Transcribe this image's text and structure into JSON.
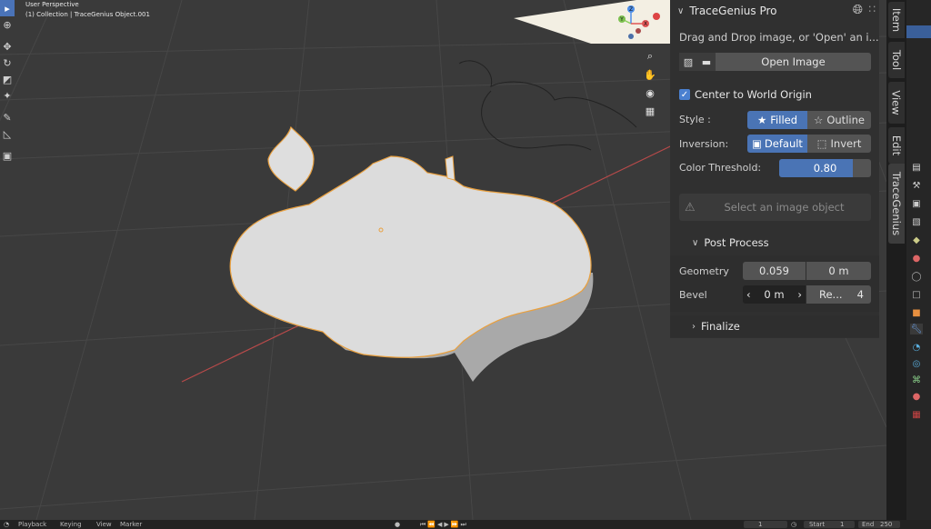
{
  "viewport": {
    "perspective": "User Perspective",
    "collection": "(1) Collection | TraceGenius Object.001"
  },
  "toolbar": {
    "tools": [
      "select-box",
      "cursor",
      "move",
      "rotate",
      "scale",
      "transform",
      "annotate",
      "measure",
      "add-cube"
    ]
  },
  "gizmo": {
    "labels": [
      "Y",
      "Z",
      "X"
    ]
  },
  "nav_icons": [
    "zoom-icon",
    "hand-icon",
    "camera-icon",
    "grid-icon"
  ],
  "panel": {
    "title": "TraceGenius Pro",
    "drop_text": "Drag and Drop image, or 'Open' an i...",
    "open_image": "Open Image",
    "center_to_world": "Center to World Origin",
    "style_label": "Style :",
    "style_filled": "Filled",
    "style_outline": "Outline",
    "inversion_label": "Inversion:",
    "inversion_default": "Default",
    "inversion_invert": "Invert",
    "threshold_label": "Color Threshold:",
    "threshold_value": "0.80",
    "threshold_fraction": 0.8,
    "select_object": "Select an image object",
    "post_process": "Post Process",
    "geometry_label": "Geometry",
    "geometry_value1": "0.059",
    "geometry_value2": "0 m",
    "bevel_label": "Bevel",
    "bevel_value": "0 m",
    "bevel_re": "Re...",
    "bevel_count": "4",
    "finalize": "Finalize"
  },
  "tabs": [
    "Item",
    "Tool",
    "View",
    "Edit",
    "TraceGenius"
  ],
  "timeline": {
    "playback": "Playback",
    "keying": "Keying",
    "view": "View",
    "marker": "Marker",
    "current_frame": "1",
    "start_label": "Start",
    "start_value": "1",
    "end_label": "End",
    "end_value": "250"
  },
  "colors": {
    "accent": "#4a74b5",
    "selection_outline": "#e8a040",
    "viewport_bg": "#3a3a3a",
    "panel_bg": "#303030"
  }
}
